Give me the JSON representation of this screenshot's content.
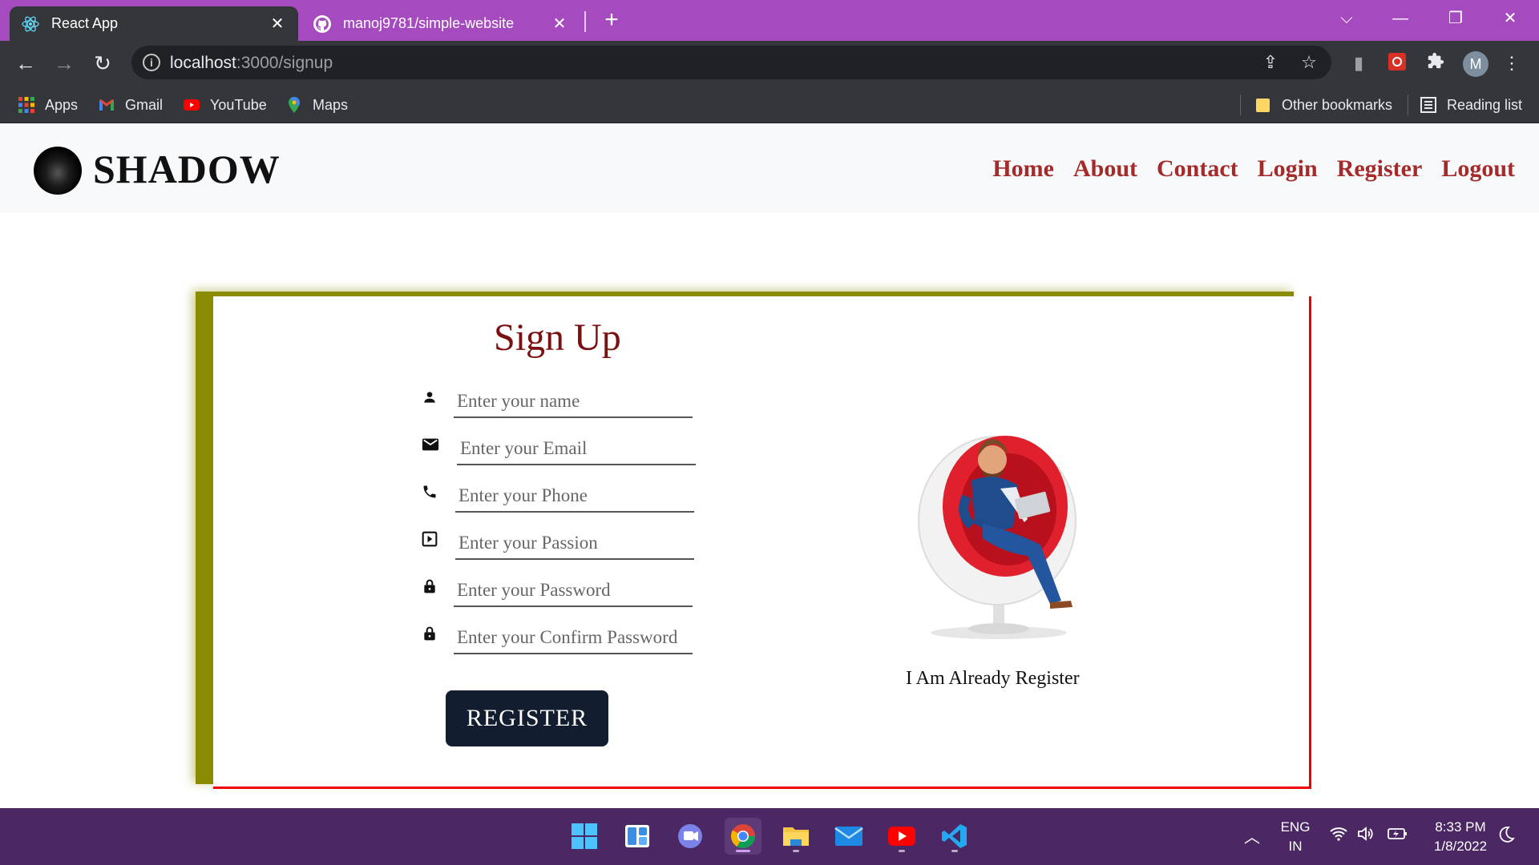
{
  "browser": {
    "tabs": [
      {
        "title": "React App",
        "icon": "react-icon",
        "active": true
      },
      {
        "title": "manoj9781/simple-website",
        "icon": "github-icon",
        "active": false
      }
    ],
    "url_host": "localhost",
    "url_path": ":3000/signup",
    "bookmarks": [
      {
        "label": "Apps",
        "icon": "apps-grid-icon"
      },
      {
        "label": "Gmail",
        "icon": "gmail-icon"
      },
      {
        "label": "YouTube",
        "icon": "youtube-icon"
      },
      {
        "label": "Maps",
        "icon": "maps-icon"
      }
    ],
    "other_bookmarks": "Other bookmarks",
    "reading_list": "Reading list",
    "avatar_letter": "M"
  },
  "site": {
    "brand": "SHADOW",
    "nav": [
      "Home",
      "About",
      "Contact",
      "Login",
      "Register",
      "Logout"
    ]
  },
  "signup": {
    "title": "Sign Up",
    "fields": [
      {
        "placeholder": "Enter your name",
        "icon": "person-icon"
      },
      {
        "placeholder": "Enter your Email",
        "icon": "email-icon"
      },
      {
        "placeholder": "Enter your Phone",
        "icon": "phone-icon"
      },
      {
        "placeholder": "Enter your Passion",
        "icon": "play-box-icon"
      },
      {
        "placeholder": "Enter your Password",
        "icon": "lock-icon"
      },
      {
        "placeholder": "Enter your Confirm Password",
        "icon": "lock-icon"
      }
    ],
    "button": "REGISTER",
    "already_link": "I Am Already Register"
  },
  "taskbar": {
    "lang_top": "ENG",
    "lang_bottom": "IN",
    "time": "8:33 PM",
    "date": "1/8/2022"
  },
  "colors": {
    "tab_strip": "#a64bbf",
    "nav_link": "#a52a2a",
    "card_border": "#ee0000",
    "card_shadow": "#8b8b00",
    "button_bg": "#121e2f",
    "taskbar": "#4b2763"
  }
}
